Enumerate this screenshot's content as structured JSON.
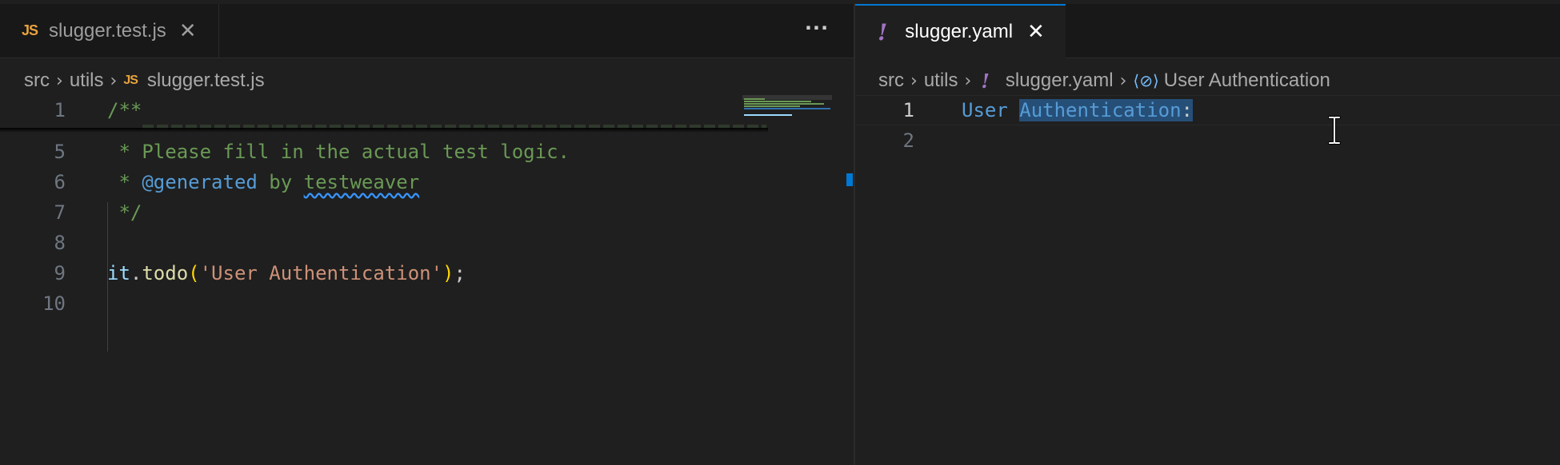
{
  "left_editor": {
    "tab": {
      "icon": "js-file-icon",
      "icon_text": "JS",
      "label": "slugger.test.js",
      "close": "✕"
    },
    "more_actions": "···",
    "breadcrumb": [
      {
        "label": "src"
      },
      {
        "label": "utils"
      },
      {
        "icon_text": "JS",
        "label": "slugger.test.js"
      }
    ],
    "lines": [
      {
        "number": "1",
        "code": "/**"
      },
      {
        "number": "5",
        "code": " * Please fill in the actual test logic."
      },
      {
        "number": "6",
        "prefix": " * ",
        "tag": "@generated",
        "middle": " by ",
        "squiggle": "testweaver"
      },
      {
        "number": "7",
        "code": " */"
      },
      {
        "number": "8",
        "code": ""
      },
      {
        "number": "9",
        "obj": "it",
        "dot": ".",
        "fn": "todo",
        "open": "(",
        "str": "'User Authentication'",
        "close": ")",
        "end": ";"
      },
      {
        "number": "10",
        "code": ""
      }
    ]
  },
  "right_editor": {
    "tab": {
      "icon": "yaml-file-icon",
      "icon_text": "!",
      "label": "slugger.yaml",
      "close": "✕"
    },
    "breadcrumb": [
      {
        "label": "src"
      },
      {
        "label": "utils"
      },
      {
        "icon_text": "!",
        "label": "slugger.yaml"
      },
      {
        "icon_text": "⟨⊘⟩",
        "label": "User Authentication"
      }
    ],
    "lines": [
      {
        "number": "1",
        "key_plain": "User ",
        "key_selected": "Authentication",
        "colon": ":"
      },
      {
        "number": "2",
        "code": ""
      }
    ]
  },
  "colors": {
    "accent": "#0078d4",
    "js_icon": "#e8a33d",
    "yaml_icon": "#a074c4",
    "comment": "#6a9955",
    "string": "#ce9178"
  }
}
